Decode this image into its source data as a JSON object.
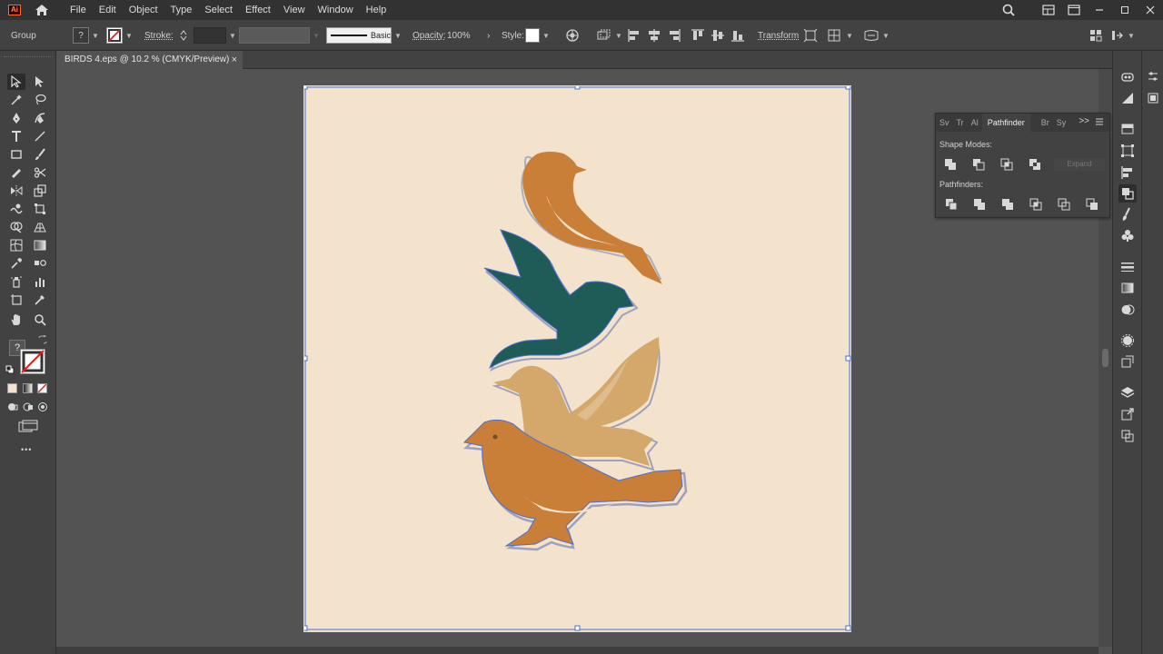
{
  "app": {
    "logo": "Ai"
  },
  "menu": [
    "File",
    "Edit",
    "Object",
    "Type",
    "Select",
    "Effect",
    "View",
    "Window",
    "Help"
  ],
  "control": {
    "selection": "Group",
    "fill_label": "?",
    "stroke_label": "Stroke:",
    "brush": "Basic",
    "opacity_label": "Opacity:",
    "opacity_value": "100%",
    "style_label": "Style:",
    "transform_label": "Transform"
  },
  "document_tab": {
    "title": "BIRDS 4.eps @ 10.2 % (CMYK/Preview)",
    "close": "×"
  },
  "tools": {
    "fill_stroke_label": "?",
    "more": "•••"
  },
  "pathfinder": {
    "tabs": [
      "Sv",
      "Tr",
      "Al",
      "Pathfinder",
      "Br",
      "Sy"
    ],
    "collapse": ">>",
    "shape_modes_label": "Shape Modes:",
    "expand_label": "Expand",
    "pathfinders_label": "Pathfinders:"
  },
  "colors": {
    "artboard": "#f3e3cd",
    "bird_orange": "#c97f37",
    "bird_teal": "#1f5c57",
    "bird_tan": "#d4a86b",
    "selection": "#4d6fd1"
  }
}
